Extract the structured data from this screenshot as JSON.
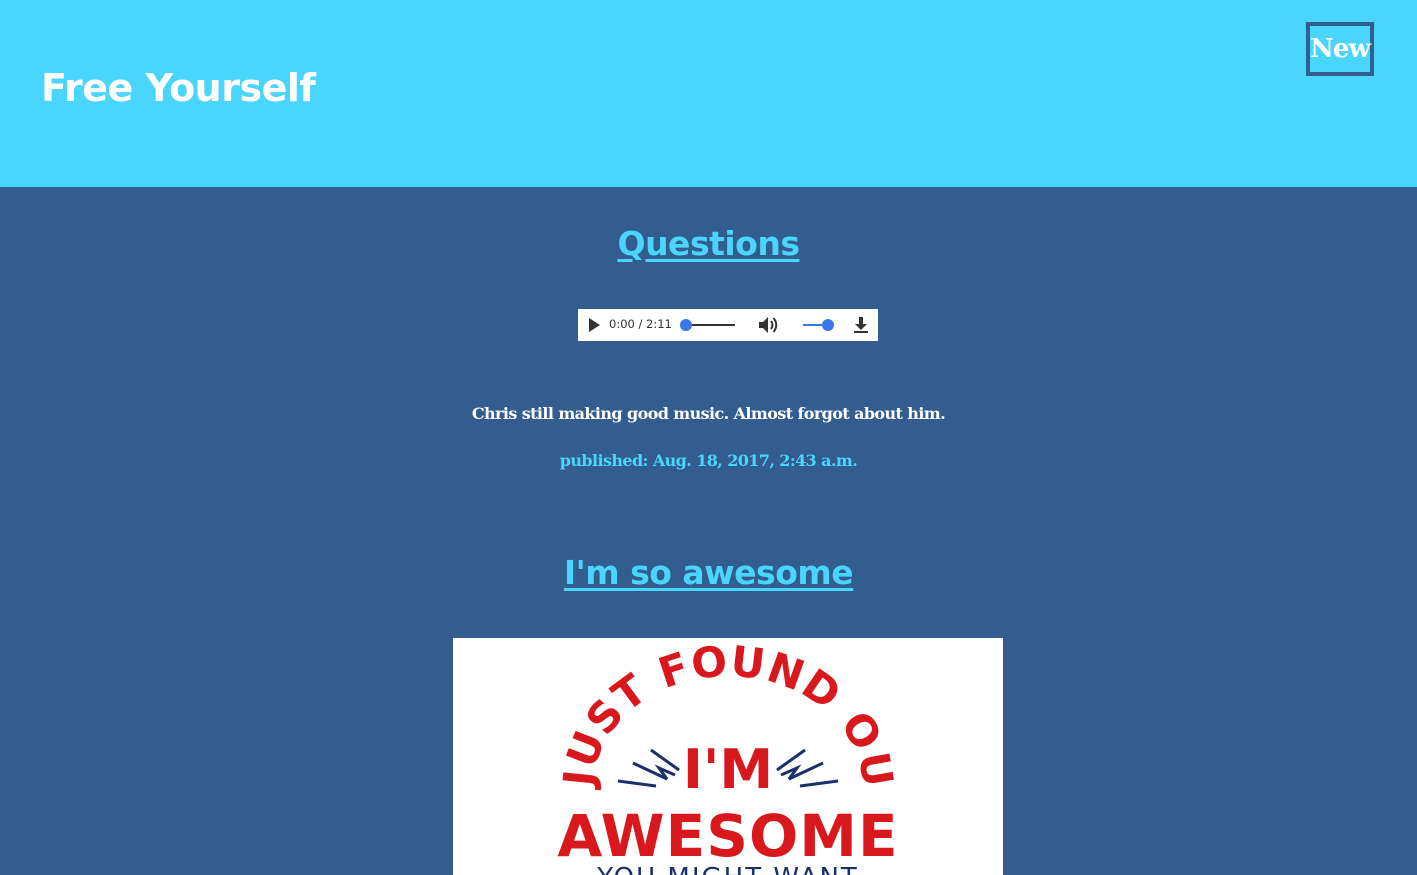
{
  "header": {
    "site_title": "Free Yourself",
    "new_button_label": "New"
  },
  "posts": [
    {
      "title": "Questions",
      "audio": {
        "time": "0:00 / 2:11",
        "progress": 0.0,
        "volume": 1.0
      },
      "body": "Chris still making good music. Almost forgot about him.",
      "published": "published: Aug. 18, 2017, 2:43 a.m."
    },
    {
      "title": "I'm so awesome",
      "image": {
        "text_line1": "I JUST FOUND OUT",
        "text_line2": "I'M",
        "text_line3": "AWESOME",
        "text_line4": "YOU MIGHT WANT"
      }
    }
  ],
  "colors": {
    "header_bg": "#4ad5fd",
    "page_bg": "#335d8f",
    "accent": "#4ad5fd",
    "image_red": "#d9181e",
    "image_navy": "#1d2f6b"
  },
  "icons": [
    "play-icon",
    "volume-icon",
    "download-icon"
  ]
}
